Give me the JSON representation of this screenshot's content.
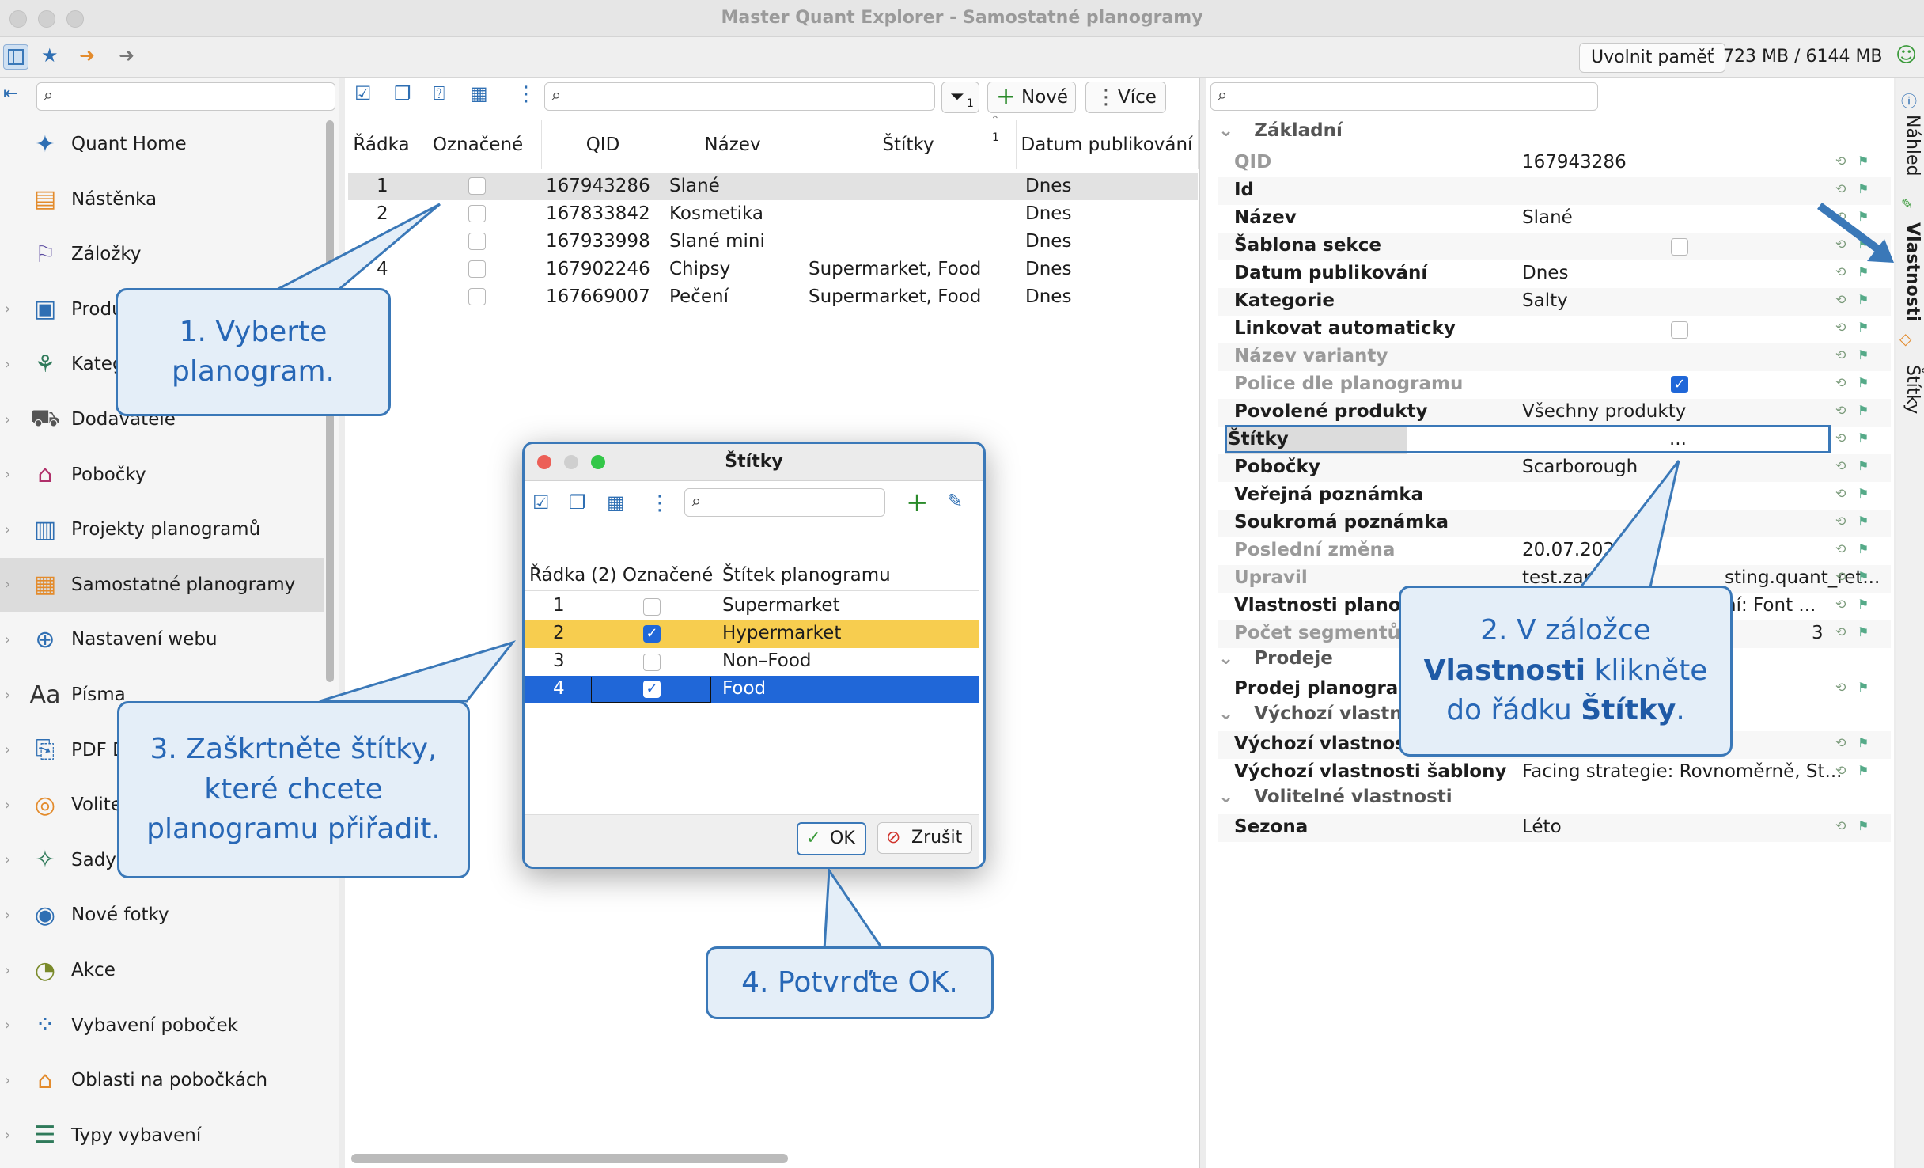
{
  "window": {
    "title": "Master Quant Explorer - Samostatné planogramy"
  },
  "toolbar": {
    "free_memory_label": "Uvolnit paměť",
    "memory_text": "723 MB / 6144 MB"
  },
  "nav": {
    "items": [
      {
        "label": "Quant Home",
        "icon": "quant-home-icon"
      },
      {
        "label": "Nástěnka",
        "icon": "dashboard-icon"
      },
      {
        "label": "Záložky",
        "icon": "bookmark-icon"
      },
      {
        "label": "Produ",
        "icon": "products-icon"
      },
      {
        "label": "Kateg",
        "icon": "categories-icon"
      },
      {
        "label": "Dodavatelé",
        "icon": "suppliers-icon"
      },
      {
        "label": "Pobočky",
        "icon": "stores-icon"
      },
      {
        "label": "Projekty planogramů",
        "icon": "projects-icon"
      },
      {
        "label": "Samostatné planogramy",
        "icon": "planograms-icon"
      },
      {
        "label": "Nastavení webu",
        "icon": "web-settings-icon"
      },
      {
        "label": "Písma",
        "icon": "fonts-icon"
      },
      {
        "label": "PDF D",
        "icon": "pdf-icon"
      },
      {
        "label": "Volite",
        "icon": "optional-icon"
      },
      {
        "label": "Sady p",
        "icon": "sets-icon"
      },
      {
        "label": "Nové fotky",
        "icon": "camera-icon"
      },
      {
        "label": "Akce",
        "icon": "clock-icon"
      },
      {
        "label": "Vybavení poboček",
        "icon": "equipment-icon"
      },
      {
        "label": "Oblasti na pobočkách",
        "icon": "areas-icon"
      },
      {
        "label": "Typy vybavení",
        "icon": "equipment-types-icon"
      }
    ]
  },
  "middle": {
    "new_label": "Nové",
    "more_label": "Více",
    "filter_badge": "1",
    "sort_badge": "1",
    "columns": [
      "Řádka",
      "Označené",
      "QID",
      "Název",
      "Štítky",
      "Datum publikování"
    ],
    "rows": [
      {
        "n": "1",
        "qid": "167943286",
        "name": "Slané",
        "tags": "",
        "date": "Dnes"
      },
      {
        "n": "2",
        "qid": "167833842",
        "name": "Kosmetika",
        "tags": "",
        "date": "Dnes"
      },
      {
        "n": "",
        "qid": "167933998",
        "name": "Slané mini",
        "tags": "",
        "date": "Dnes"
      },
      {
        "n": "4",
        "qid": "167902246",
        "name": "Chipsy",
        "tags": "Supermarket, Food",
        "date": "Dnes"
      },
      {
        "n": "",
        "qid": "167669007",
        "name": "Pečení",
        "tags": "Supermarket, Food",
        "date": "Dnes"
      }
    ]
  },
  "properties": {
    "sections": [
      "Základní",
      "Prodeje",
      "Výchozí vlastnost",
      "Volitelné vlastnosti"
    ],
    "rows": [
      {
        "key": "QID",
        "value": "167943286"
      },
      {
        "key": "Id",
        "value": ""
      },
      {
        "key": "Název",
        "value": "Slané"
      },
      {
        "key": "Šablona sekce",
        "value": ""
      },
      {
        "key": "Datum publikování",
        "value": "Dnes"
      },
      {
        "key": "Kategorie",
        "value": "Salty"
      },
      {
        "key": "Linkovat automaticky",
        "value": ""
      },
      {
        "key": "Název varianty",
        "value": ""
      },
      {
        "key": "Police dle planogramu",
        "value": ""
      },
      {
        "key": "Povolené produkty",
        "value": "Všechny produkty"
      },
      {
        "key": "Štítky",
        "value": "..."
      },
      {
        "key": "Pobočky",
        "value": "Scarborough"
      },
      {
        "key": "Veřejná poznámka",
        "value": ""
      },
      {
        "key": "Soukromá poznámka",
        "value": ""
      },
      {
        "key": "Poslední změna",
        "value": "20.07.2020"
      },
      {
        "key": "Upravil",
        "value": "test.zap",
        "value2": "sting.quant_ret..."
      },
      {
        "key": "Vlastnosti planogr",
        "value2": "ní: Font ..."
      },
      {
        "key": "Počet segmentů s",
        "value2": "3"
      },
      {
        "key": "Prodej planogram",
        "value": ""
      },
      {
        "key": "Výchozí vlastnosti",
        "value": ""
      },
      {
        "key": "Výchozí vlastnosti šablony",
        "value": "Facing strategie: Rovnoměrně, St..."
      },
      {
        "key": "Sezona",
        "value": "Léto"
      }
    ]
  },
  "side_tabs": [
    "Náhled",
    "Vlastnosti",
    "Štítky"
  ],
  "dialog": {
    "title": "Štítky",
    "columns": [
      "Řádka",
      "(2) Označené",
      "Štítek planogramu"
    ],
    "rows": [
      {
        "n": "1",
        "label": "Supermarket",
        "checked": false
      },
      {
        "n": "2",
        "label": "Hypermarket",
        "checked": true
      },
      {
        "n": "3",
        "label": "Non–Food",
        "checked": false
      },
      {
        "n": "4",
        "label": "Food",
        "checked": true
      }
    ],
    "ok_label": "OK",
    "cancel_label": "Zrušit"
  },
  "callouts": {
    "c1_line1": "1. Vyberte",
    "c1_line2": "planogram.",
    "c2_line1": "2. V záložce",
    "c2_bold1": "Vlastnosti",
    "c2_rest1": " klikněte",
    "c2_line3a": "do řádku ",
    "c2_bold2": "Štítky",
    "c2_end": ".",
    "c3_line1": "3. Zaškrtněte štítky,",
    "c3_line2": "které chcete",
    "c3_line3": "planogramu přiřadit.",
    "c4": "4. Potvrďte OK."
  },
  "colors": {
    "accent": "#3a78b8",
    "selected_row": "#2067d8",
    "highlight_row": "#f7cd4f",
    "callout_bg": "#e4eef8"
  }
}
